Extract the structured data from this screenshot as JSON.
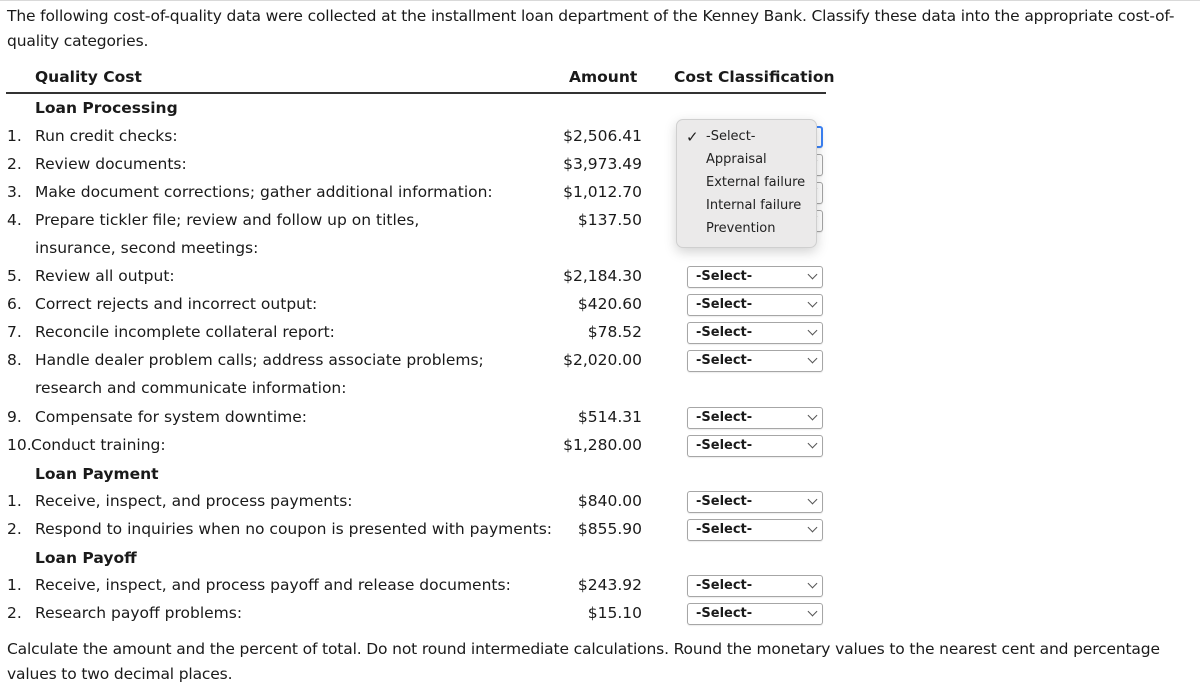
{
  "intro": "The following cost-of-quality data were collected at the installment loan department of the Kenney Bank. Classify these data into the appropriate cost-of-quality categories.",
  "table": {
    "headers": {
      "quality_cost": "Quality Cost",
      "amount": "Amount",
      "classification": "Cost Classification"
    },
    "sections": [
      {
        "title": "Loan Processing",
        "items": [
          {
            "num": "1.",
            "desc": "Run credit checks:",
            "amount": "$2,506.41",
            "classification": "-Select-"
          },
          {
            "num": "2.",
            "desc": "Review documents:",
            "amount": "$3,973.49",
            "classification": "-Select-"
          },
          {
            "num": "3.",
            "desc": "Make document corrections; gather additional information:",
            "amount": "$1,012.70",
            "classification": "-Select-"
          },
          {
            "num": "4.",
            "desc": "Prepare tickler file; review and follow up on titles,",
            "desc_cont": "insurance, second meetings:",
            "amount": "$137.50",
            "classification": "-Select-"
          },
          {
            "num": "5.",
            "desc": "Review all output:",
            "amount": "$2,184.30",
            "classification": "-Select-"
          },
          {
            "num": "6.",
            "desc": "Correct rejects and incorrect output:",
            "amount": "$420.60",
            "classification": "-Select-"
          },
          {
            "num": "7.",
            "desc": "Reconcile incomplete collateral report:",
            "amount": "$78.52",
            "classification": "-Select-"
          },
          {
            "num": "8.",
            "desc": "Handle dealer problem calls; address associate problems;",
            "desc_cont": "research and communicate information:",
            "amount": "$2,020.00",
            "classification": "-Select-"
          },
          {
            "num": "9.",
            "desc": "Compensate for system downtime:",
            "amount": "$514.31",
            "classification": "-Select-"
          },
          {
            "num": "10.",
            "desc": "Conduct training:",
            "amount": "$1,280.00",
            "classification": "-Select-"
          }
        ]
      },
      {
        "title": "Loan Payment",
        "items": [
          {
            "num": "1.",
            "desc": "Receive, inspect, and process payments:",
            "amount": "$840.00",
            "classification": "-Select-"
          },
          {
            "num": "2.",
            "desc": "Respond to inquiries when no coupon is presented with payments:",
            "amount": "$855.90",
            "classification": "-Select-"
          }
        ]
      },
      {
        "title": "Loan Payoff",
        "items": [
          {
            "num": "1.",
            "desc": "Receive, inspect, and process payoff and release documents:",
            "amount": "$243.92",
            "classification": "-Select-"
          },
          {
            "num": "2.",
            "desc": "Research payoff problems:",
            "amount": "$15.10",
            "classification": "-Select-"
          }
        ]
      }
    ]
  },
  "dropdown_open": {
    "selected": "-Select-",
    "options": [
      "-Select-",
      "Appraisal",
      "External failure",
      "Internal failure",
      "Prevention"
    ],
    "check_icon": "✓"
  },
  "footer": "Calculate the amount and the percent of total. Do not round intermediate calculations. Round the monetary values to the nearest cent and percentage values to two decimal places.",
  "colors": {
    "focus_border": "#3b82f6",
    "text": "#1a1a1a",
    "popup_bg": "#ebeaea"
  }
}
